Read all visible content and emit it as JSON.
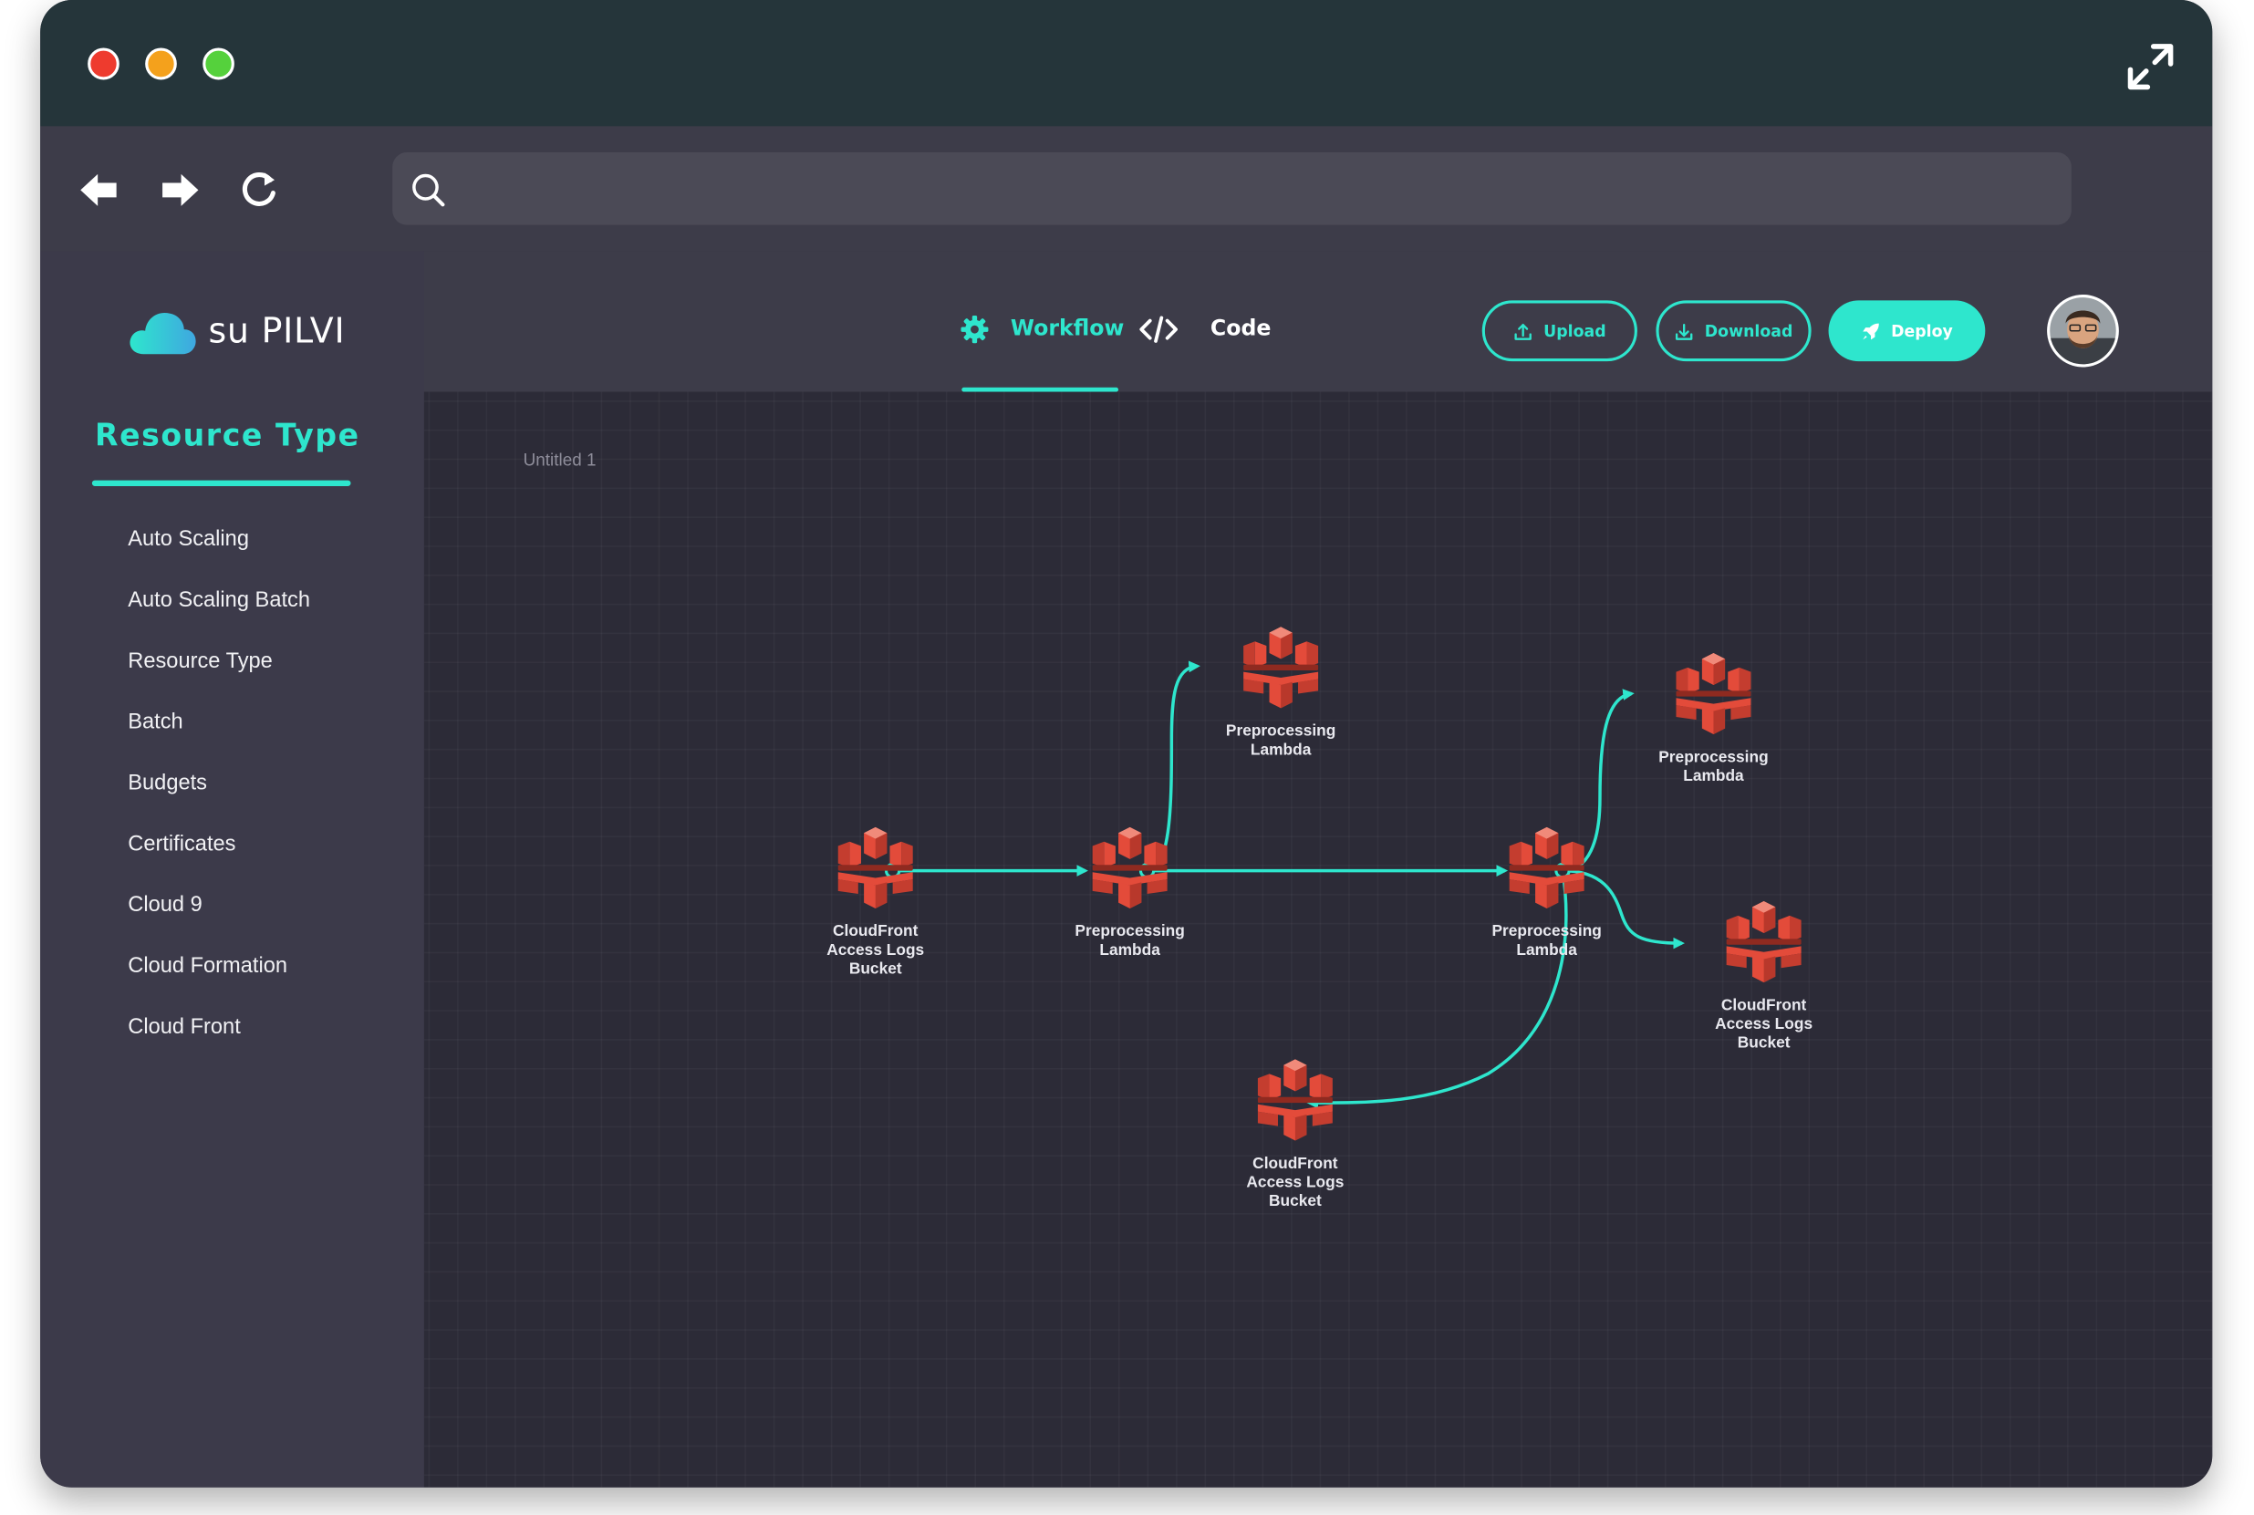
{
  "browser": {
    "search": {
      "value": "",
      "placeholder": ""
    }
  },
  "colors": {
    "accent": "#2ee6cd",
    "titlebar": "#25353a",
    "sidebar": "#3c3a4a",
    "canvas": "#2c2b37",
    "node": "#e34b3a"
  },
  "icons": {
    "window": [
      "close-dot",
      "minimize-dot",
      "maximize-dot",
      "expand-icon"
    ],
    "toolbar": [
      "back-arrow-icon",
      "forward-arrow-icon",
      "reload-icon",
      "search-icon"
    ],
    "nodes": "aws-cloudfront-icon"
  },
  "app": {
    "logo_text": "su PILVI"
  },
  "sidebar": {
    "heading": "Resource Type",
    "items": [
      {
        "label": "Auto Scaling"
      },
      {
        "label": "Auto Scaling Batch"
      },
      {
        "label": "Resource Type"
      },
      {
        "label": "Batch"
      },
      {
        "label": "Budgets"
      },
      {
        "label": "Certificates"
      },
      {
        "label": "Cloud 9"
      },
      {
        "label": "Cloud Formation"
      },
      {
        "label": "Cloud Front"
      }
    ]
  },
  "header": {
    "tabs": [
      {
        "label": "Workflow",
        "icon": "gear-icon",
        "active": true
      },
      {
        "label": "Code",
        "icon": "code-icon",
        "active": false
      }
    ],
    "buttons": {
      "upload": "Upload",
      "download": "Download",
      "deploy": "Deploy"
    }
  },
  "canvas": {
    "title": "Untitled 1",
    "nodes": [
      {
        "label": "CloudFront\nAccess Logs\nBucket"
      },
      {
        "label": "Preprocessing\nLambda"
      },
      {
        "label": "Preprocessing\nLambda"
      },
      {
        "label": "Preprocessing\nLambda"
      },
      {
        "label": "Preprocessing\nLambda"
      },
      {
        "label": "CloudFront\nAccess Logs\nBucket"
      },
      {
        "label": "CloudFront\nAccess Logs\nBucket"
      }
    ]
  }
}
